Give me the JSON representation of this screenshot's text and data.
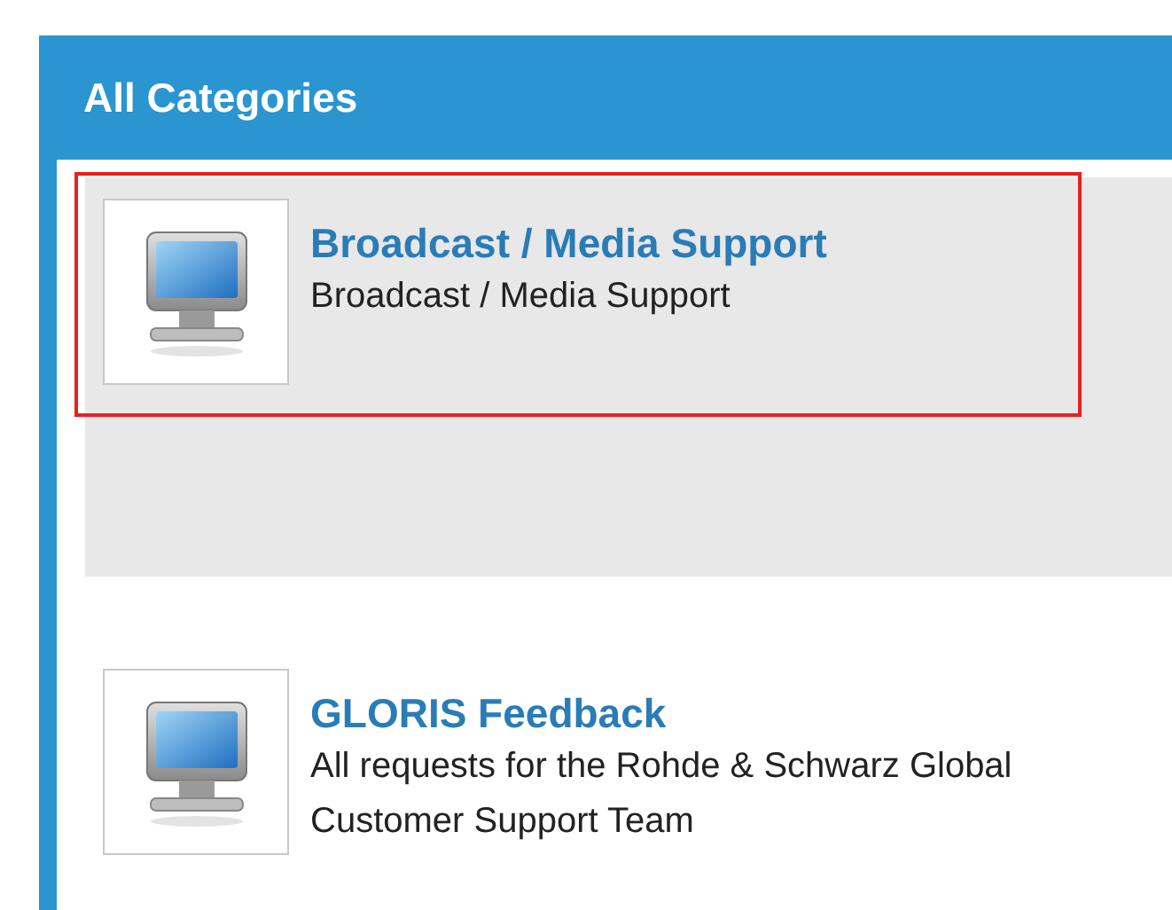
{
  "panel": {
    "title": "All Categories"
  },
  "categories": [
    {
      "title": "Broadcast / Media Support",
      "description": "Broadcast / Media Support",
      "selected": true
    },
    {
      "title": "GLORIS Feedback",
      "description": "All requests for the Rohde & Schwarz Global Customer Support Team",
      "selected": false
    }
  ]
}
